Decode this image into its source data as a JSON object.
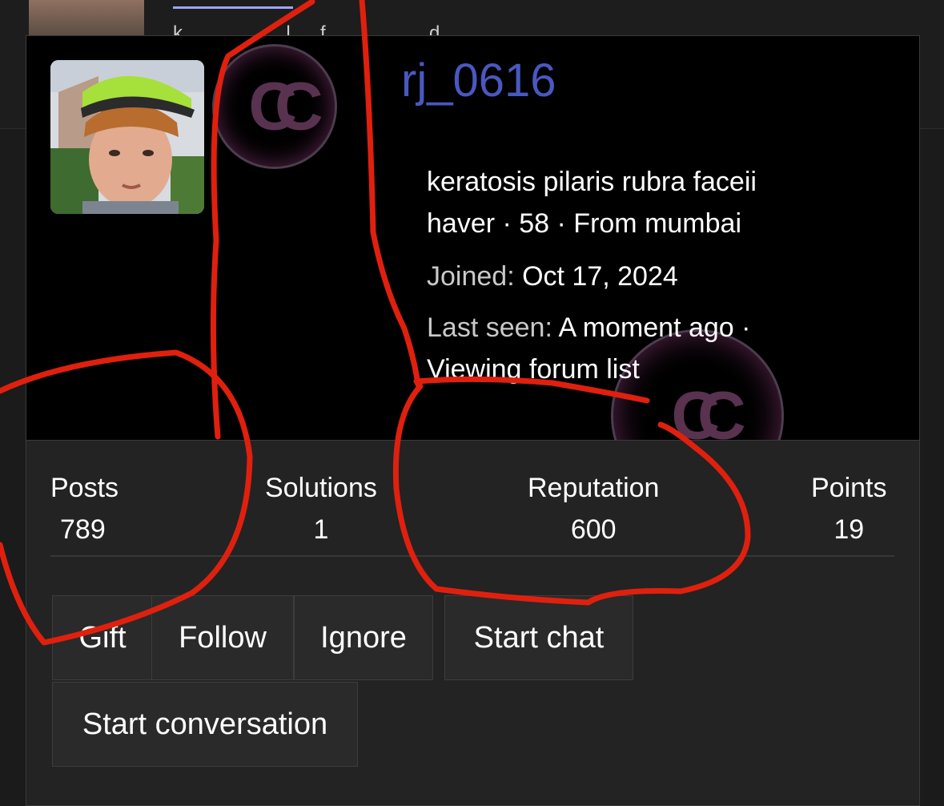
{
  "background": {
    "subtitle_fragment": "k … … … … l … f … … … … d"
  },
  "profile": {
    "username": "rj_0616",
    "about": "keratosis pilaris rubra faceii haver · 58 · From mumbai",
    "joined_label": "Joined:",
    "joined_value": "Oct 17, 2024",
    "last_seen_label": "Last seen:",
    "last_seen_value": "A moment ago · Viewing forum list"
  },
  "stats": [
    {
      "label": "Posts",
      "value": "789"
    },
    {
      "label": "Solutions",
      "value": "1"
    },
    {
      "label": "Reputation",
      "value": "600"
    },
    {
      "label": "Points",
      "value": "19"
    }
  ],
  "actions": {
    "gift": "Gift",
    "follow": "Follow",
    "ignore": "Ignore",
    "start_chat": "Start chat",
    "start_conversation": "Start conversation"
  },
  "colors": {
    "username": "#4958c0",
    "annotation": "#e0200e",
    "banner": "#000000",
    "card": "#232323"
  }
}
